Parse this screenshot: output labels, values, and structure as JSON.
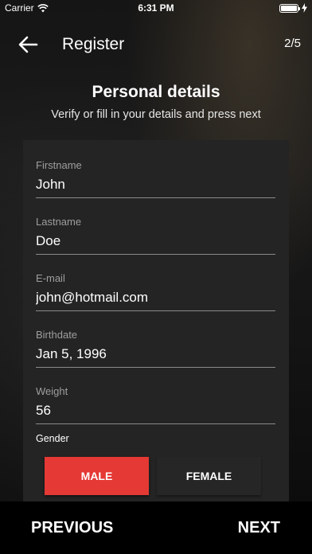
{
  "status_bar": {
    "carrier": "Carrier",
    "time": "6:31 PM"
  },
  "header": {
    "title": "Register",
    "step": "2/5"
  },
  "section": {
    "title": "Personal details",
    "subtitle": "Verify or fill in your details and press next"
  },
  "form": {
    "fields": [
      {
        "label": "Firstname",
        "value": "John"
      },
      {
        "label": "Lastname",
        "value": "Doe"
      },
      {
        "label": "E-mail",
        "value": "john@hotmail.com"
      },
      {
        "label": "Birthdate",
        "value": "Jan 5, 1996"
      },
      {
        "label": "Weight",
        "value": "56"
      }
    ],
    "gender_label": "Gender",
    "gender_options": [
      "MALE",
      "FEMALE"
    ],
    "gender_selected": "MALE"
  },
  "footer": {
    "previous_label": "PREVIOUS",
    "next_label": "NEXT"
  },
  "colors": {
    "accent": "#e53935",
    "card": "#242424",
    "bottom_bar": "#000000"
  },
  "icons": [
    "wifi-icon",
    "battery-icon",
    "charging-icon",
    "back-arrow-icon"
  ]
}
